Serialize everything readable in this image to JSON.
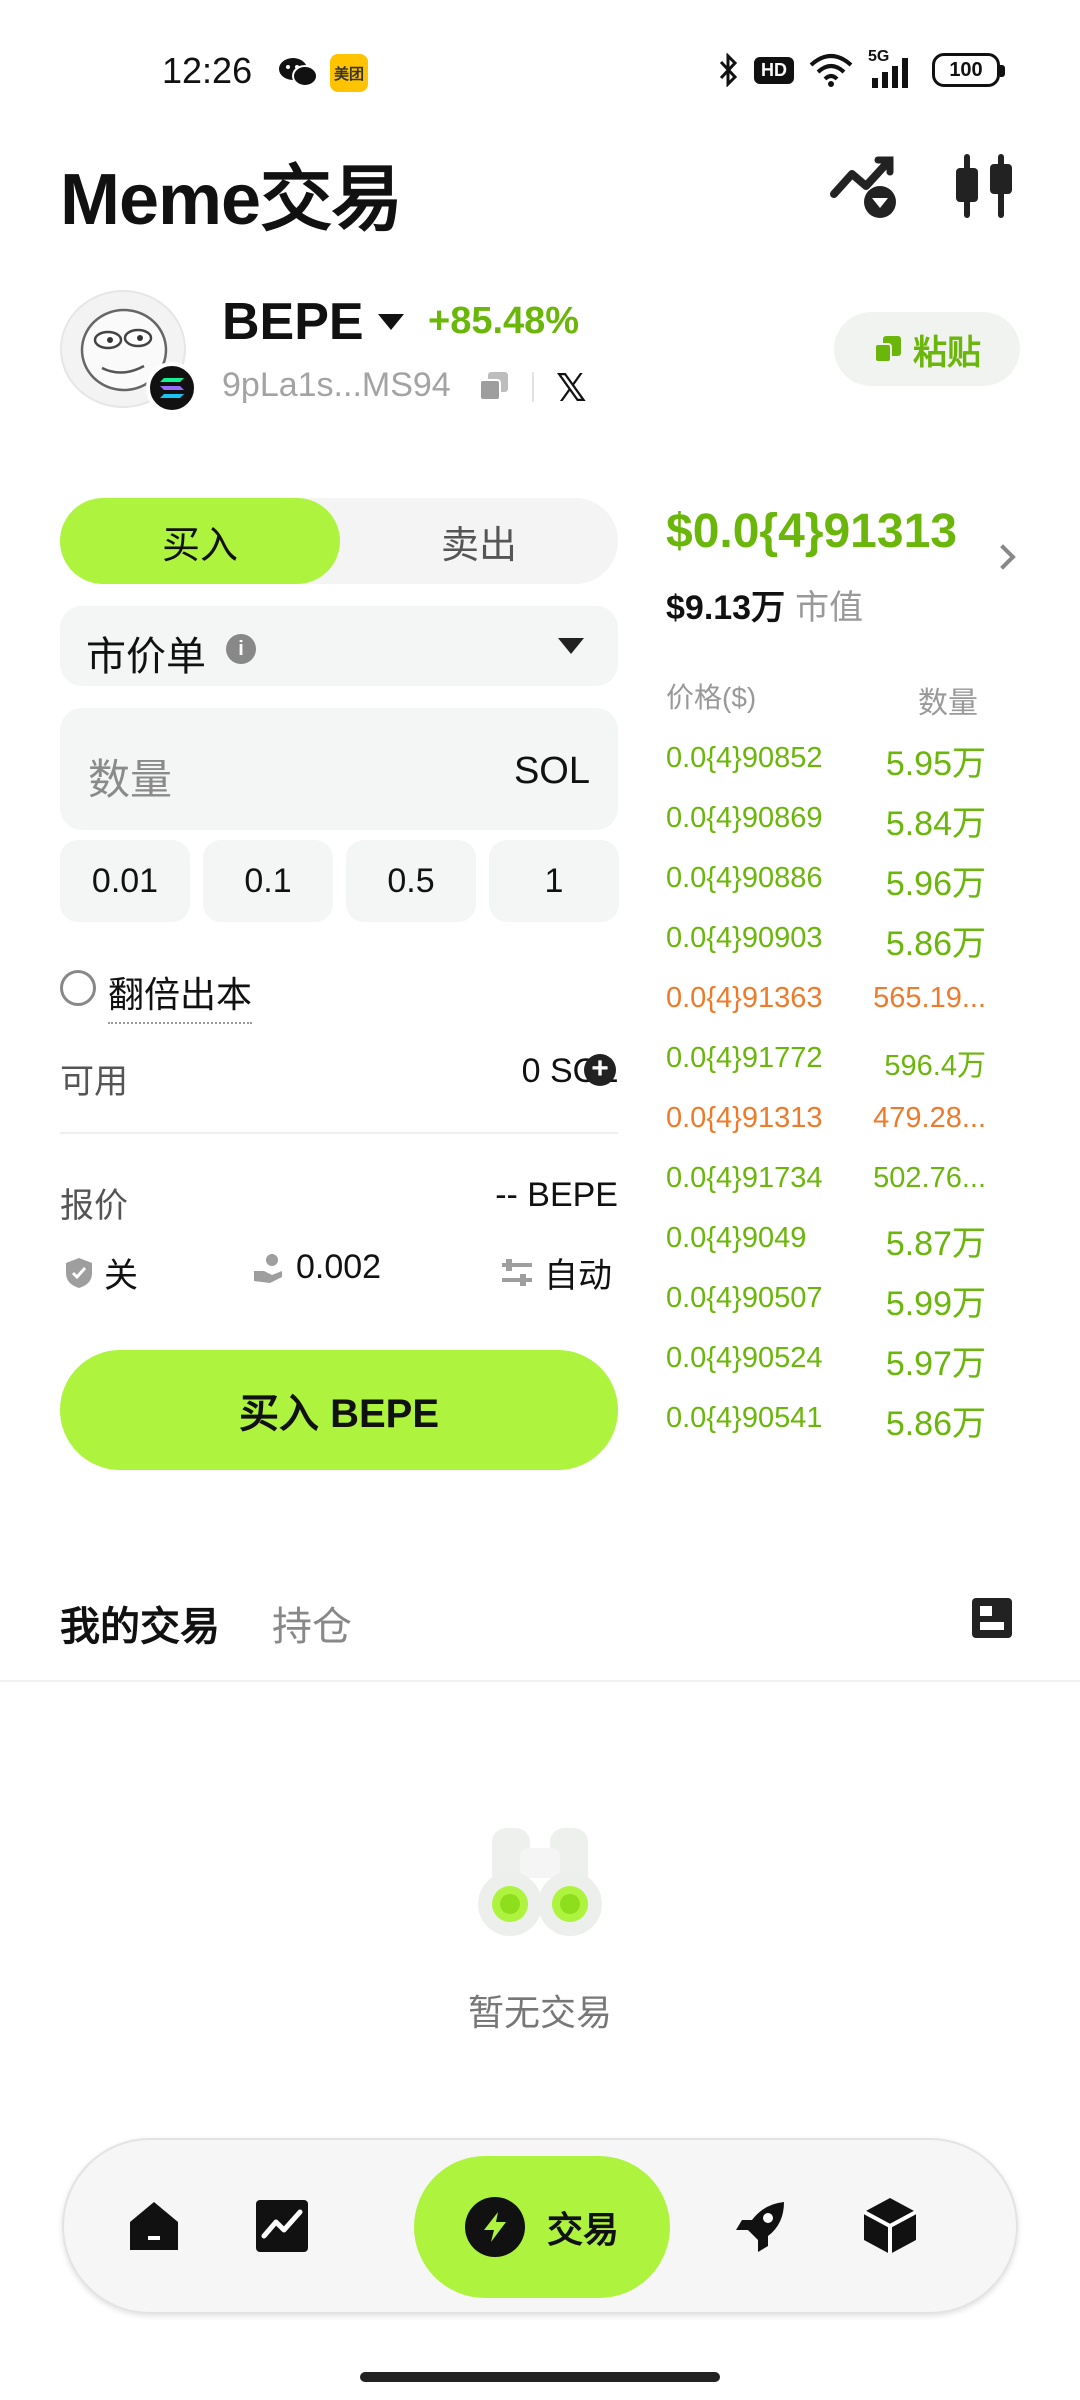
{
  "status_bar": {
    "time": "12:26",
    "meituan_label": "美团",
    "network": "5G",
    "hd_label": "HD",
    "battery": "100"
  },
  "header": {
    "title": "Meme交易"
  },
  "token": {
    "name": "BEPE",
    "change": "+85.48%",
    "address": "9pLa1s...MS94",
    "x_label": "𝕏",
    "paste_label": "粘贴"
  },
  "trade_form": {
    "buy_tab": "买入",
    "sell_tab": "卖出",
    "order_type": "市价单",
    "info_glyph": "i",
    "quantity_placeholder": "数量",
    "quantity_unit": "SOL",
    "quick_amounts": [
      "0.01",
      "0.1",
      "0.5",
      "1"
    ],
    "double_out_label": "翻倍出本",
    "available_label": "可用",
    "available_value": "0 SOL",
    "plus_glyph": "+",
    "quote_label": "报价",
    "quote_value": "-- BEPE",
    "mev_protect": "关",
    "slippage": "0.002",
    "gas_mode": "自动",
    "buy_button": "买入 BEPE"
  },
  "order_book": {
    "last_price": "$0.0{4}91313",
    "market_cap_value": "$9.13万",
    "market_cap_label": "市值",
    "header_price": "价格($)",
    "header_qty": "数量",
    "rows": [
      {
        "price": "0.0{4}90852",
        "qty": "5.95万"
      },
      {
        "price": "0.0{4}90869",
        "qty": "5.84万"
      },
      {
        "price": "0.0{4}90886",
        "qty": "5.96万"
      },
      {
        "price": "0.0{4}90903",
        "qty": "5.86万"
      },
      {
        "price": "0.0{4}91363",
        "qty": "565.19..."
      },
      {
        "price": "0.0{4}91772",
        "qty": "596.4万"
      },
      {
        "price": "0.0{4}91313",
        "qty": "479.28..."
      },
      {
        "price": "0.0{4}91734",
        "qty": "502.76..."
      },
      {
        "price": "0.0{4}9049",
        "qty": "5.87万"
      },
      {
        "price": "0.0{4}90507",
        "qty": "5.99万"
      },
      {
        "price": "0.0{4}90524",
        "qty": "5.97万"
      },
      {
        "price": "0.0{4}90541",
        "qty": "5.86万"
      }
    ]
  },
  "trades_section": {
    "tab_mine": "我的交易",
    "tab_positions": "持仓",
    "empty_text": "暂无交易"
  },
  "bottom_nav": {
    "active_label": "交易"
  },
  "colors": {
    "accent": "#aef33d",
    "up": "#6bb60a",
    "down": "#ee7a2a"
  }
}
